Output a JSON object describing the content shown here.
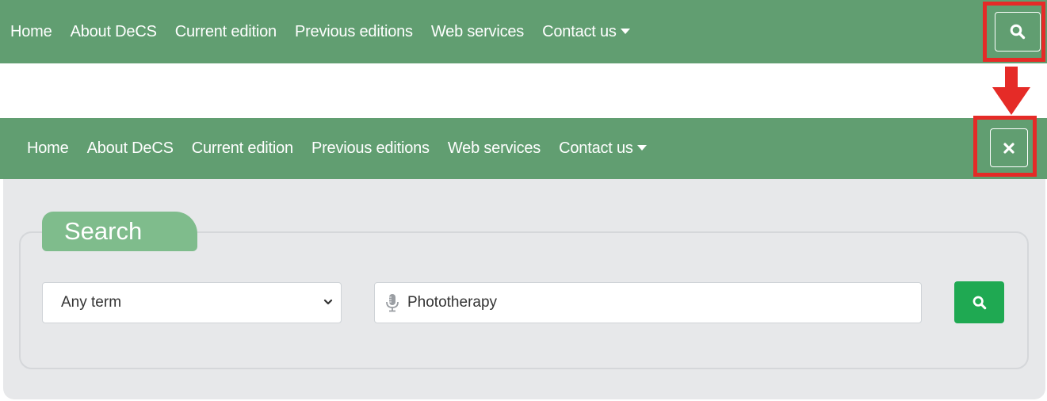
{
  "top_nav": {
    "items": [
      "Home",
      "About DeCS",
      "Current edition",
      "Previous editions",
      "Web services"
    ],
    "contact_label": "Contact us",
    "search_toggle_icon": "search-icon"
  },
  "bottom_nav": {
    "items": [
      "Home",
      "About DeCS",
      "Current edition",
      "Previous editions",
      "Web services"
    ],
    "contact_label": "Contact us",
    "close_icon": "close-icon"
  },
  "search_panel": {
    "legend": "Search",
    "select_value": "Any term",
    "input_value": "Phototherapy",
    "submit_icon": "search-icon"
  },
  "colors": {
    "nav_green": "#619e71",
    "legend_green": "#7fbc8c",
    "button_green": "#1fa952",
    "highlight_red": "#e52b27",
    "panel_gray": "#e7e8ea"
  }
}
